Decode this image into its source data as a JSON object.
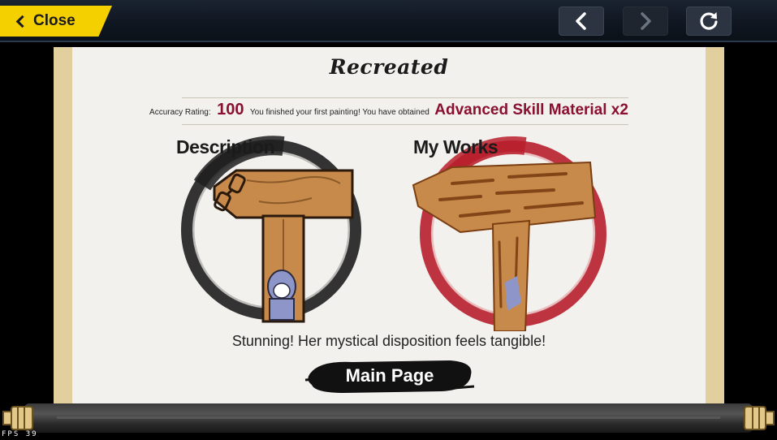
{
  "header": {
    "close_label": "Close"
  },
  "result": {
    "title": "Recreated",
    "accuracy_label": "Accuracy Rating:",
    "accuracy_value": "100",
    "message": "You finished your first painting! You have obtained",
    "reward": "Advanced Skill Material x2",
    "description_heading": "Description",
    "works_heading": "My Works",
    "caption": "Stunning! Her mystical disposition feels tangible!",
    "main_page_label": "Main Page"
  },
  "debug": {
    "fps_label": "FPS",
    "fps_value": "39"
  },
  "colors": {
    "close_button": "#f4d000",
    "reward_text": "#8a1030",
    "ink_ring_left": "#1e1e1e",
    "ink_ring_right": "#b81e2c",
    "wood": "#c88a4a",
    "scroll_edge": "#e1cf9e"
  }
}
